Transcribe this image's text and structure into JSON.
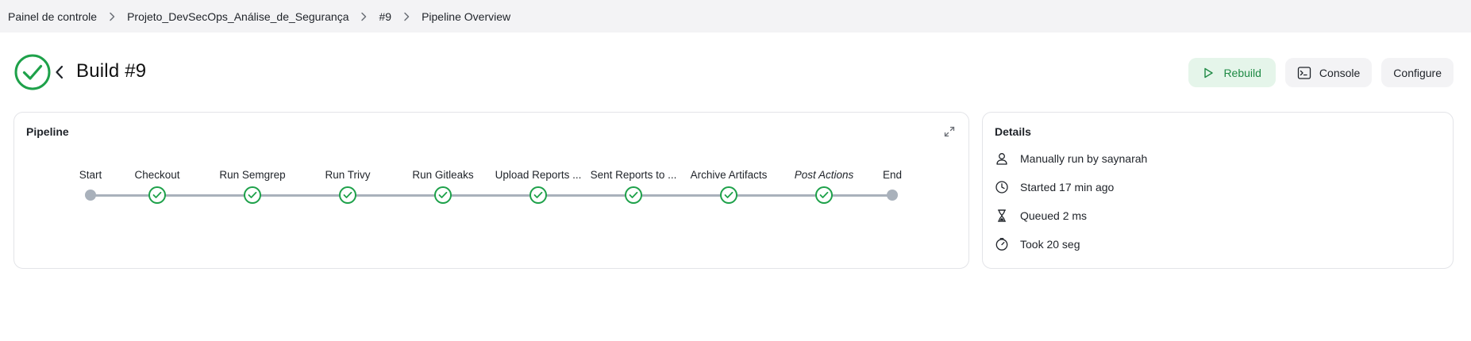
{
  "breadcrumb": {
    "items": [
      {
        "label": "Painel de controle"
      },
      {
        "label": "Projeto_DevSecOps_Análise_de_Segurança"
      },
      {
        "label": "#9"
      },
      {
        "label": "Pipeline Overview"
      }
    ]
  },
  "header": {
    "title": "Build #9",
    "status": "success",
    "status_icon": "check-circle-icon"
  },
  "actions": {
    "rebuild_label": "Rebuild",
    "console_label": "Console",
    "configure_label": "Configure"
  },
  "pipeline": {
    "title": "Pipeline",
    "stages": [
      {
        "label": "Start",
        "kind": "start"
      },
      {
        "label": "Checkout",
        "kind": "success"
      },
      {
        "label": "Run Semgrep",
        "kind": "success"
      },
      {
        "label": "Run Trivy",
        "kind": "success"
      },
      {
        "label": "Run Gitleaks",
        "kind": "success"
      },
      {
        "label": "Upload Reports ...",
        "kind": "success"
      },
      {
        "label": "Sent Reports to ...",
        "kind": "success"
      },
      {
        "label": "Archive Artifacts",
        "kind": "success"
      },
      {
        "label": "Post Actions",
        "kind": "success",
        "italic": true
      },
      {
        "label": "End",
        "kind": "end"
      }
    ]
  },
  "details": {
    "title": "Details",
    "rows": [
      {
        "icon": "user-icon",
        "text": "Manually run by saynarah"
      },
      {
        "icon": "clock-icon",
        "text": "Started 17 min ago"
      },
      {
        "icon": "hourglass-icon",
        "text": "Queued 2 ms"
      },
      {
        "icon": "timer-icon",
        "text": "Took 20 seg"
      }
    ]
  },
  "colors": {
    "success": "#1ea14a",
    "rebuild_bg": "#e5f5ea",
    "track": "#a9b1bb"
  }
}
